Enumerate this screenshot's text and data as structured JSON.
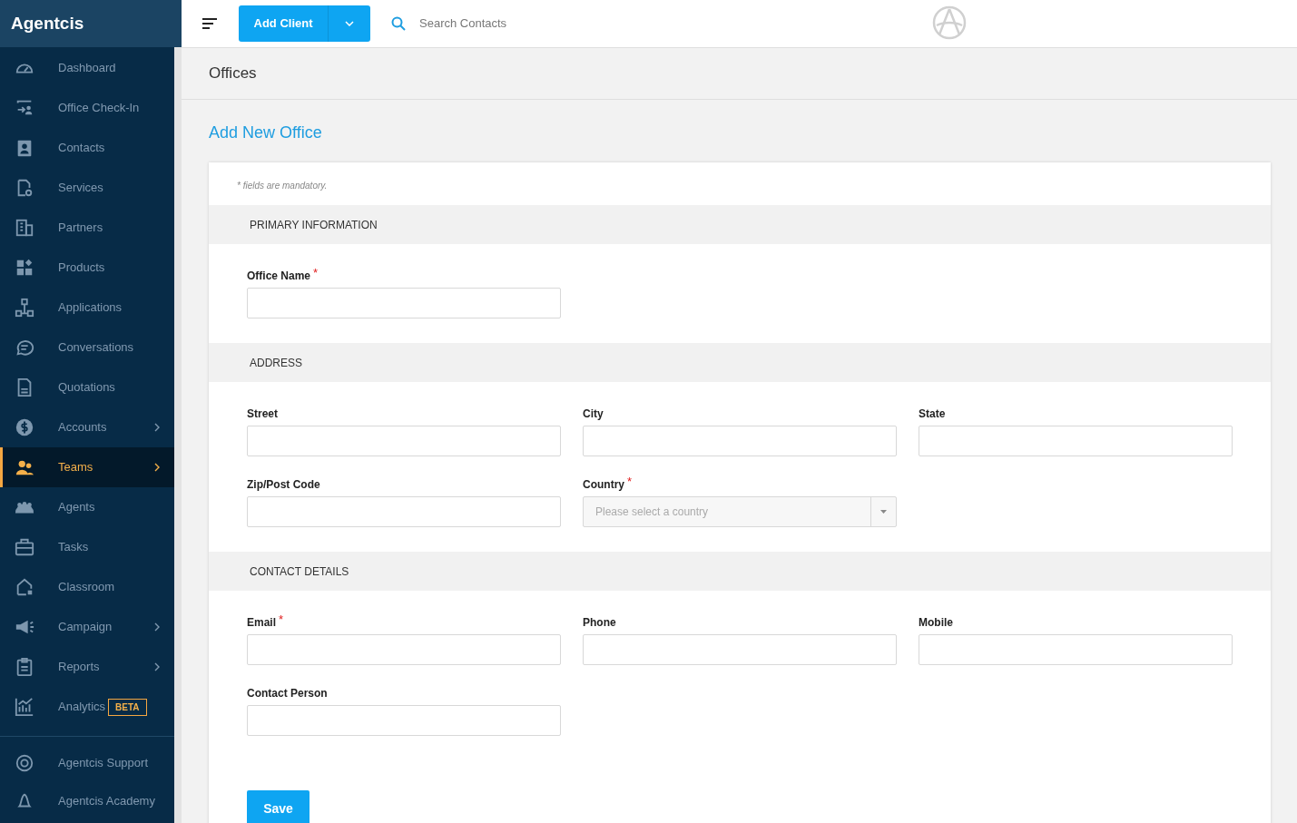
{
  "brand": "Agentcis",
  "sidebar": {
    "items": [
      {
        "label": "Dashboard",
        "selected": false,
        "submenu": false
      },
      {
        "label": "Office Check-In",
        "selected": false,
        "submenu": false
      },
      {
        "label": "Contacts",
        "selected": false,
        "submenu": false
      },
      {
        "label": "Services",
        "selected": false,
        "submenu": false
      },
      {
        "label": "Partners",
        "selected": false,
        "submenu": false
      },
      {
        "label": "Products",
        "selected": false,
        "submenu": false
      },
      {
        "label": "Applications",
        "selected": false,
        "submenu": false
      },
      {
        "label": "Conversations",
        "selected": false,
        "submenu": false
      },
      {
        "label": "Quotations",
        "selected": false,
        "submenu": false
      },
      {
        "label": "Accounts",
        "selected": false,
        "submenu": true
      },
      {
        "label": "Teams",
        "selected": true,
        "submenu": true
      },
      {
        "label": "Agents",
        "selected": false,
        "submenu": false
      },
      {
        "label": "Tasks",
        "selected": false,
        "submenu": false
      },
      {
        "label": "Classroom",
        "selected": false,
        "submenu": false
      },
      {
        "label": "Campaign",
        "selected": false,
        "submenu": true
      },
      {
        "label": "Reports",
        "selected": false,
        "submenu": true
      },
      {
        "label": "Analytics",
        "selected": false,
        "submenu": false,
        "badge": "BETA"
      }
    ],
    "footer_items": [
      {
        "label": "Agentcis Support",
        "selected": false
      },
      {
        "label": "Agentcis Academy",
        "selected": false
      }
    ]
  },
  "topbar": {
    "add_button": "Add Client",
    "search": {
      "placeholder": "Search Contacts"
    }
  },
  "page_title": "Offices",
  "form": {
    "title": "Add New Office",
    "note": "* fields are mandatory.",
    "save_button": "Save",
    "sections": [
      {
        "title": "PRIMARY INFORMATION",
        "rows": [
          [
            {
              "label": "Office Name",
              "kind": "text",
              "mark": "*"
            }
          ]
        ]
      },
      {
        "title": "ADDRESS",
        "rows": [
          [
            {
              "label": "Street",
              "kind": "text"
            },
            {
              "label": "City",
              "kind": "text"
            },
            {
              "label": "State",
              "kind": "text"
            }
          ],
          [
            {
              "label": "Zip/Post Code",
              "kind": "text"
            },
            {
              "label": "Country",
              "kind": "select",
              "mark": "*",
              "placeholder": "Please select a country"
            }
          ]
        ]
      },
      {
        "title": "CONTACT DETAILS",
        "rows": [
          [
            {
              "label": "Email",
              "kind": "text",
              "mark": "*"
            },
            {
              "label": "Phone",
              "kind": "text"
            },
            {
              "label": "Mobile",
              "kind": "text"
            }
          ],
          [
            {
              "label": "Contact Person",
              "kind": "text"
            }
          ]
        ]
      }
    ]
  }
}
